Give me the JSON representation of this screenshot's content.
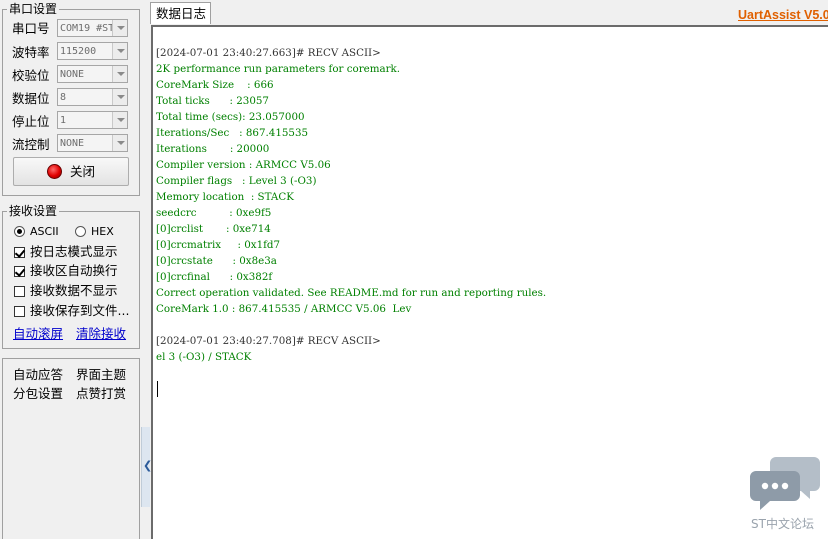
{
  "brand": "UartAssist V5.0.",
  "serial_settings": {
    "title": "串口设置",
    "rows": [
      {
        "label": "串口号",
        "value": "COM19 #ST"
      },
      {
        "label": "波特率",
        "value": "115200"
      },
      {
        "label": "校验位",
        "value": "NONE"
      },
      {
        "label": "数据位",
        "value": "8"
      },
      {
        "label": "停止位",
        "value": "1"
      },
      {
        "label": "流控制",
        "value": "NONE"
      }
    ],
    "close_button": "关闭",
    "close_indicator_color": "#e00000"
  },
  "receive_settings": {
    "title": "接收设置",
    "format": {
      "ascii": "ASCII",
      "hex": "HEX",
      "selected": "ASCII"
    },
    "options": [
      {
        "label": "按日志模式显示",
        "checked": true
      },
      {
        "label": "接收区自动换行",
        "checked": true
      },
      {
        "label": "接收数据不显示",
        "checked": false
      },
      {
        "label": "接收保存到文件...",
        "checked": false
      }
    ],
    "links": {
      "auto_scroll": "自动滚屏",
      "clear": "清除接收"
    }
  },
  "extra": {
    "auto_reply": "自动应答",
    "theme": "界面主题",
    "packet_settings": "分包设置",
    "donate": "点赞打赏"
  },
  "log_tab": "数据日志",
  "log_lines": [
    {
      "text": "[2024-07-01 23:40:27.663]# RECV ASCII>",
      "kind": "hdr"
    },
    {
      "text": "2K performance run parameters for coremark.",
      "kind": "data"
    },
    {
      "text": "CoreMark Size    : 666",
      "kind": "data"
    },
    {
      "text": "Total ticks      : 23057",
      "kind": "data"
    },
    {
      "text": "Total time (secs): 23.057000",
      "kind": "data"
    },
    {
      "text": "Iterations/Sec   : 867.415535",
      "kind": "data"
    },
    {
      "text": "Iterations       : 20000",
      "kind": "data"
    },
    {
      "text": "Compiler version : ARMCC V5.06",
      "kind": "data"
    },
    {
      "text": "Compiler flags   : Level 3 (-O3)",
      "kind": "data"
    },
    {
      "text": "Memory location  : STACK",
      "kind": "data"
    },
    {
      "text": "seedcrc          : 0xe9f5",
      "kind": "data"
    },
    {
      "text": "[0]crclist       : 0xe714",
      "kind": "data"
    },
    {
      "text": "[0]crcmatrix     : 0x1fd7",
      "kind": "data"
    },
    {
      "text": "[0]crcstate      : 0x8e3a",
      "kind": "data"
    },
    {
      "text": "[0]crcfinal      : 0x382f",
      "kind": "data"
    },
    {
      "text": "Correct operation validated. See README.md for run and reporting rules.",
      "kind": "data"
    },
    {
      "text": "CoreMark 1.0 : 867.415535 / ARMCC V5.06  Lev",
      "kind": "data"
    },
    {
      "text": "",
      "kind": "blank"
    },
    {
      "text": "[2024-07-01 23:40:27.708]# RECV ASCII>",
      "kind": "hdr"
    },
    {
      "text": "el 3 (-O3) / STACK",
      "kind": "data"
    }
  ],
  "watermark": "ST中文论坛",
  "colors": {
    "log_data": "#008000",
    "link": "#0000cc",
    "brand": "#e06000"
  }
}
